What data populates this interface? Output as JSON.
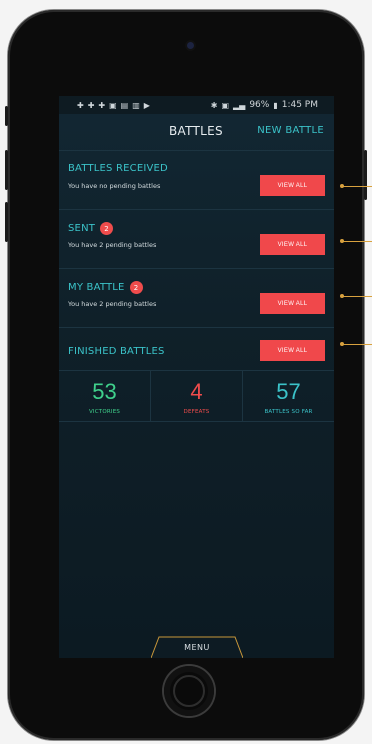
{
  "status_bar": {
    "left_icons": [
      "✚",
      "✚",
      "✚",
      "▣",
      "▤",
      "▥",
      "▶"
    ],
    "battery": "96%",
    "time": "1:45 PM"
  },
  "header": {
    "title": "BATTLES",
    "action": "NEW BATTLE"
  },
  "sections": [
    {
      "title": "BATTLES RECEIVED",
      "badge": "",
      "subtitle": "You have no pending battles",
      "button": "VIEW ALL"
    },
    {
      "title": "SENT",
      "badge": "2",
      "subtitle": "You have 2 pending battles",
      "button": "VIEW ALL"
    },
    {
      "title": "MY BATTLE",
      "badge": "2",
      "subtitle": "You have 2 pending battles",
      "button": "VIEW ALL"
    },
    {
      "title": "FINISHED BATTLES",
      "badge": "",
      "subtitle": "",
      "button": "VIEW ALL"
    }
  ],
  "stats": [
    {
      "value": "53",
      "label": "VICTORIES",
      "color": "#3fd18c"
    },
    {
      "value": "4",
      "label": "DEFEATS",
      "color": "#ef4c4c"
    },
    {
      "value": "57",
      "label": "BATTLES SO FAR",
      "color": "#3bc3c9"
    }
  ],
  "menu_label": "MENU",
  "colors": {
    "accent": "#3bc3c9",
    "button": "#f0484b",
    "callout": "#d9a23f"
  }
}
